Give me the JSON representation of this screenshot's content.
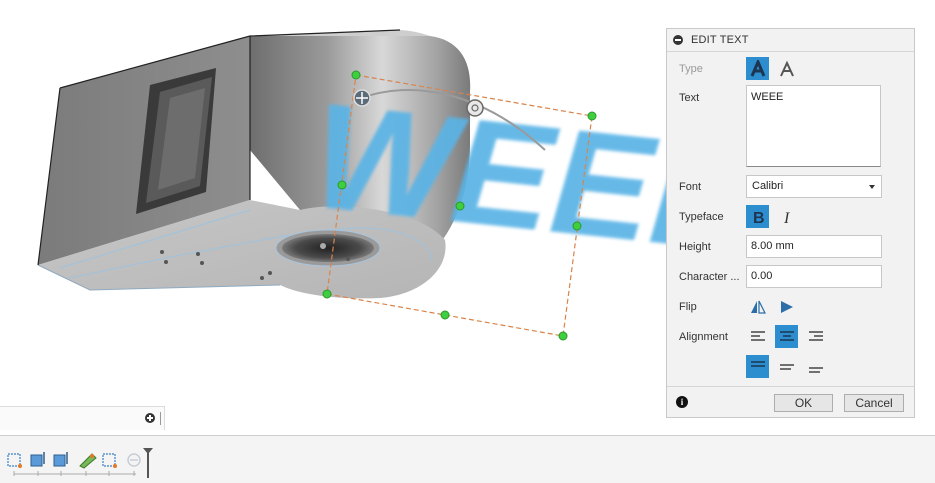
{
  "viewport": {
    "text_object": "WEEE"
  },
  "panel": {
    "title": "EDIT TEXT",
    "type_label": "Type",
    "text_label": "Text",
    "text_value": "WEEE",
    "font_label": "Font",
    "font_value": "Calibri",
    "typeface_label": "Typeface",
    "height_label": "Height",
    "height_value": "8.00 mm",
    "character_label": "Character ...",
    "character_value": "0.00",
    "flip_label": "Flip",
    "alignment_label": "Alignment",
    "ok_label": "OK",
    "cancel_label": "Cancel"
  },
  "colors": {
    "accent": "#2c8ecf",
    "text_object": "#5ab4e6",
    "sketch_dash": "#d9844a",
    "handle": "#3fce3f"
  }
}
